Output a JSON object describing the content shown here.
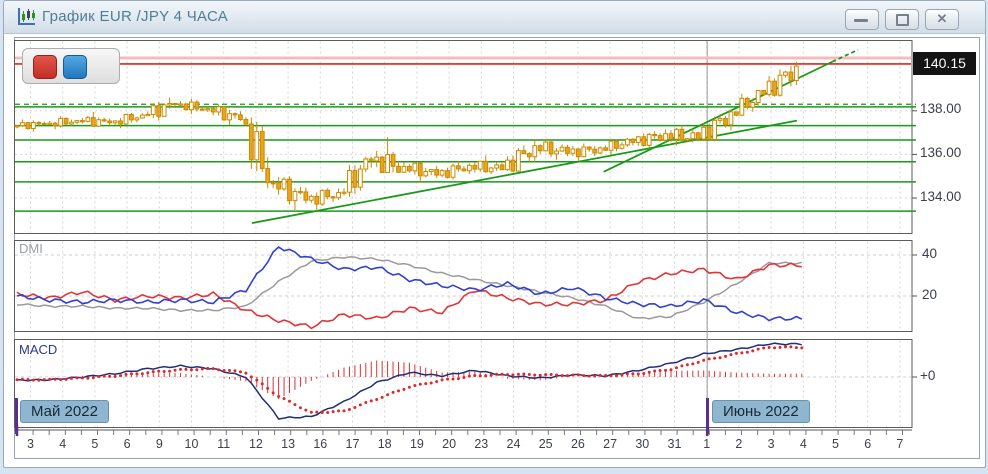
{
  "window": {
    "title": "График EUR /JPY  4 ЧАСА",
    "controls": {
      "close_glyph": "✕"
    }
  },
  "months": {
    "may": "Май 2022",
    "june": "Июнь 2022"
  },
  "chart_data": {
    "type": "candlestick",
    "symbol": "EUR/JPY",
    "timeframe": "4 часа",
    "x_labels": [
      "3",
      "4",
      "5",
      "6",
      "9",
      "10",
      "11",
      "12",
      "13",
      "16",
      "17",
      "18",
      "19",
      "20",
      "23",
      "24",
      "25",
      "26",
      "27",
      "30",
      "31",
      "1",
      "2",
      "3",
      "4",
      "5",
      "6",
      "7"
    ],
    "price_axis": {
      "ticks": [
        {
          "label": "138.00",
          "value": 138
        },
        {
          "label": "136.00",
          "value": 136
        },
        {
          "label": "134.00",
          "value": 134
        }
      ],
      "current": {
        "label": "140.15",
        "value": 140.15
      }
    },
    "candles_daily_ohlc": [
      [
        137.3,
        137.6,
        137.05,
        137.4
      ],
      [
        137.4,
        137.75,
        137.15,
        137.55
      ],
      [
        137.55,
        137.95,
        137.25,
        137.45
      ],
      [
        137.45,
        137.9,
        137.2,
        137.8
      ],
      [
        137.8,
        138.6,
        137.55,
        138.3
      ],
      [
        138.3,
        138.55,
        137.85,
        138.1
      ],
      [
        138.1,
        138.3,
        137.35,
        137.6
      ],
      [
        137.6,
        137.7,
        134.45,
        134.7
      ],
      [
        134.7,
        135.0,
        133.45,
        133.9
      ],
      [
        133.9,
        134.45,
        133.4,
        134.25
      ],
      [
        134.25,
        135.9,
        134.05,
        135.7
      ],
      [
        135.7,
        136.8,
        135.15,
        135.45
      ],
      [
        135.45,
        135.65,
        134.7,
        135.05
      ],
      [
        135.05,
        135.7,
        134.85,
        135.5
      ],
      [
        135.5,
        135.95,
        135.1,
        135.3
      ],
      [
        135.3,
        136.65,
        135.2,
        136.4
      ],
      [
        136.4,
        136.7,
        135.75,
        136.05
      ],
      [
        136.05,
        136.5,
        135.7,
        136.3
      ],
      [
        136.3,
        136.75,
        136.0,
        136.55
      ],
      [
        136.55,
        137.15,
        136.25,
        136.95
      ],
      [
        136.95,
        137.35,
        136.4,
        136.7
      ],
      [
        136.7,
        138.05,
        136.6,
        137.95
      ],
      [
        137.95,
        138.95,
        137.75,
        138.75
      ],
      [
        138.75,
        140.25,
        138.65,
        140.05
      ]
    ],
    "levels_green": [
      138.18,
      137.32,
      136.66,
      135.66,
      134.74,
      133.4
    ],
    "level_green_dashed": 138.3,
    "alert_line_red": 140.15,
    "alert_line_pink": 140.42,
    "trendlines": [
      {
        "t1": 6.88,
        "p1": 132.85,
        "t2": 23.8,
        "p2": 137.55
      },
      {
        "t1": 17.8,
        "p1": 135.2,
        "t2": 24.9,
        "p2": 140.25,
        "ext_t": 25.7,
        "ext_p": 140.8
      }
    ],
    "month_separator_day_index": 21,
    "dmi": {
      "label": "DMI",
      "axis": [
        {
          "label": "40",
          "value": 40
        },
        {
          "label": "20",
          "value": 20
        }
      ],
      "plus_di": [
        20,
        18,
        17,
        18,
        17,
        18,
        17,
        23,
        44,
        38,
        33,
        34,
        28,
        25,
        23,
        26,
        21,
        24,
        19,
        16,
        15,
        18,
        12,
        9
      ],
      "minus_di": [
        21,
        19,
        22,
        18,
        20,
        19,
        21,
        13,
        8,
        5,
        11,
        9,
        14,
        12,
        23,
        19,
        16,
        16,
        18,
        27,
        31,
        33,
        28,
        35
      ],
      "adx": [
        16,
        15,
        15,
        14,
        14,
        13,
        13,
        15,
        27,
        37,
        39,
        38,
        35,
        31,
        28,
        25,
        22,
        19,
        15,
        9,
        10,
        17,
        26,
        36
      ],
      "colors": {
        "plus": "#3340cf",
        "minus": "#e03636",
        "adx": "#9a9a9a"
      }
    },
    "macd": {
      "label": "MACD",
      "axis": [
        {
          "label": "+0",
          "value": 0
        }
      ],
      "macd": [
        -0.06,
        -0.05,
        0.0,
        0.06,
        0.15,
        0.2,
        0.15,
        0.0,
        -0.75,
        -0.72,
        -0.45,
        -0.1,
        0.08,
        0.02,
        0.12,
        0.02,
        -0.02,
        0.04,
        0.02,
        0.12,
        0.25,
        0.42,
        0.5,
        0.6
      ],
      "signal": [
        -0.05,
        -0.05,
        -0.02,
        0.02,
        0.08,
        0.13,
        0.15,
        0.08,
        -0.35,
        -0.65,
        -0.62,
        -0.4,
        -0.18,
        -0.06,
        0.02,
        0.05,
        0.04,
        0.03,
        0.02,
        0.06,
        0.14,
        0.3,
        0.42,
        0.54
      ],
      "colors": {
        "macd": "#1f2f7a",
        "signal": "#e02828",
        "histogram": "#e03030"
      }
    },
    "colors": {
      "candle": "#e8a41c",
      "candle_edge": "#c88a00",
      "level_green": "#1a9a1a",
      "alert_red": "#e02020",
      "alert_pink": "#f2bcbc",
      "grid": "#d4d4d4",
      "separator": "#9a9a9a",
      "month_bar": "#5b2d8e"
    }
  }
}
